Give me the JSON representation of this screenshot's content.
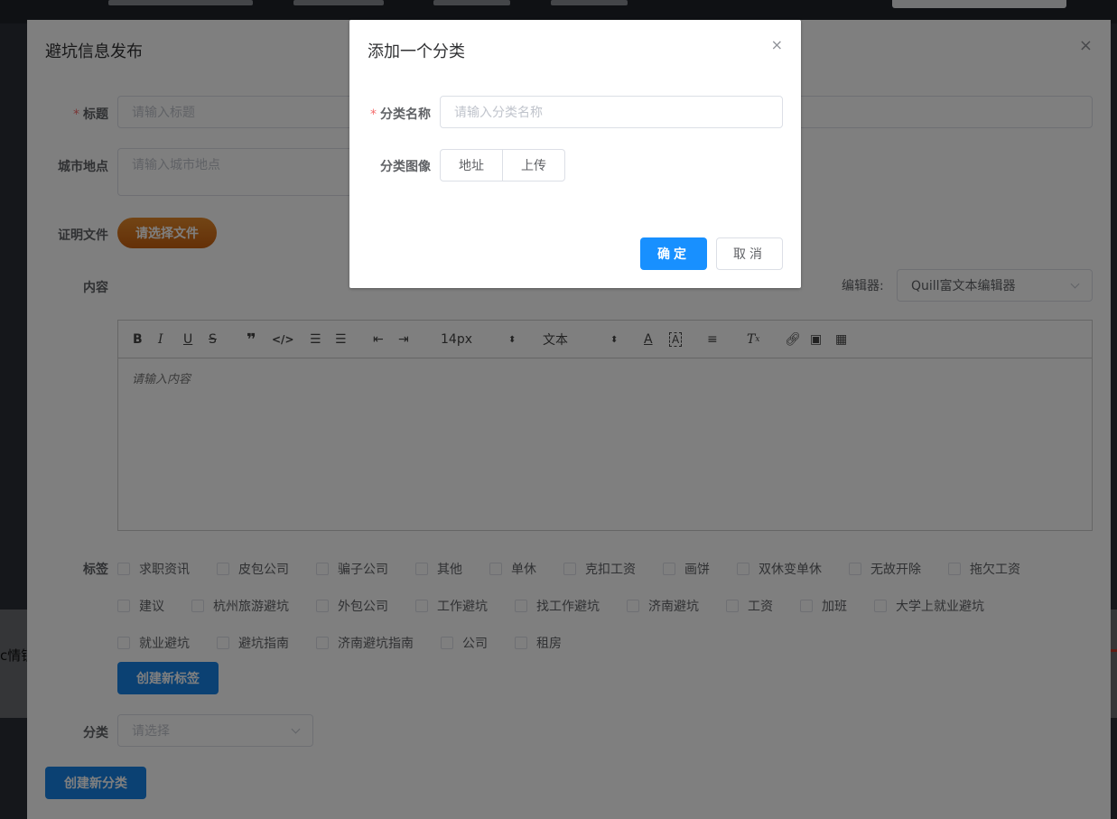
{
  "drawer": {
    "title": "避坑信息发布",
    "close_icon": "×"
  },
  "form": {
    "title_label": "标题",
    "title_placeholder": "请输入标题",
    "city_label": "城市地点",
    "city_placeholder": "请输入城市地点",
    "file_label": "证明文件",
    "file_button": "请选择文件",
    "content_label": "内容",
    "editor_label": "编辑器:",
    "editor_value": "Quill富文本编辑器",
    "toolbar": {
      "size": "14px",
      "header": "文本"
    },
    "content_placeholder": "请输入内容",
    "tags_label": "标签",
    "tags_row1": [
      "求职资讯",
      "皮包公司",
      "骗子公司",
      "其他",
      "单休",
      "克扣工资",
      "画饼",
      "双休变单休",
      "无故开除",
      "拖欠工资"
    ],
    "tags_row2": [
      "建议",
      "杭州旅游避坑",
      "外包公司",
      "工作避坑",
      "找工作避坑",
      "济南避坑",
      "工资",
      "加班",
      "大学上就业避坑"
    ],
    "tags_row3": [
      "就业避坑",
      "避坑指南",
      "济南避坑指南",
      "公司",
      "租房"
    ],
    "create_tag_button": "创建新标签",
    "category_label": "分类",
    "category_placeholder": "请选择",
    "create_category_button": "创建新分类"
  },
  "background": {
    "left_text": "c情锁"
  },
  "modal": {
    "title": "添加一个分类",
    "close_icon": "×",
    "name_label": "分类名称",
    "name_placeholder": "请输入分类名称",
    "image_label": "分类图像",
    "image_options": [
      "地址",
      "上传"
    ],
    "ok_button": "确定",
    "cancel_button": "取消"
  },
  "colors": {
    "primary": "#1890ff",
    "required": "#f56c6c",
    "file_button": "#d9731d"
  }
}
